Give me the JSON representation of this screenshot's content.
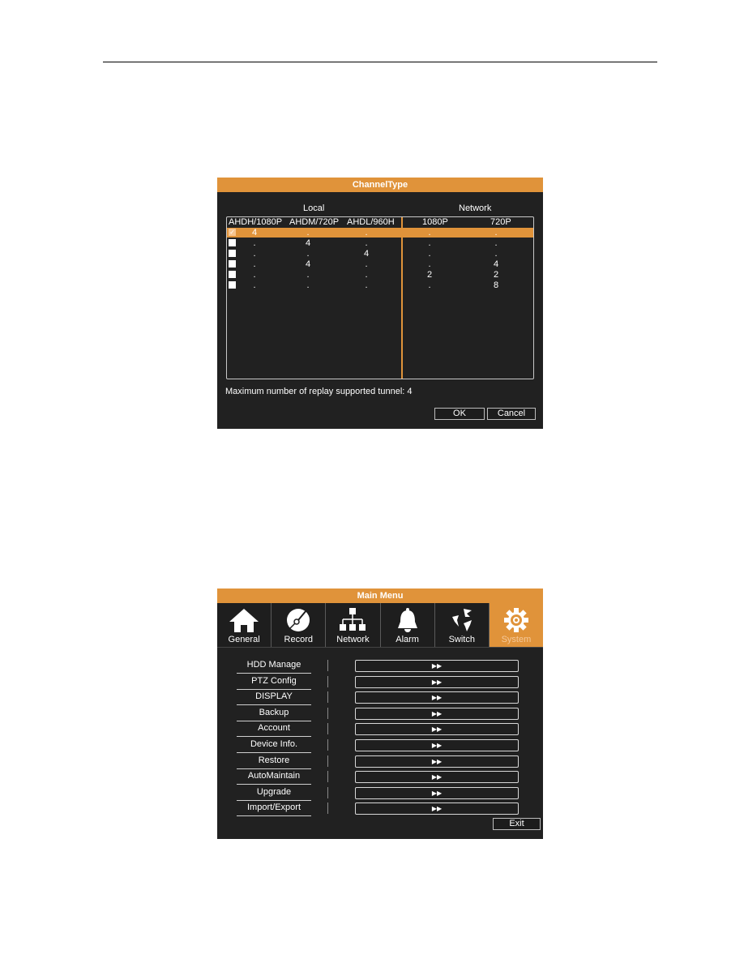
{
  "channel_type": {
    "title": "ChannelType",
    "groups": {
      "local": "Local",
      "network": "Network"
    },
    "columns": [
      "AHDH/1080P",
      "AHDM/720P",
      "AHDL/960H",
      "1080P",
      "720P"
    ],
    "rows": [
      {
        "checked": true,
        "values": [
          "4",
          ".",
          ".",
          ".",
          "."
        ]
      },
      {
        "checked": false,
        "values": [
          ".",
          "4",
          ".",
          ".",
          "."
        ]
      },
      {
        "checked": false,
        "values": [
          ".",
          ".",
          "4",
          ".",
          "."
        ]
      },
      {
        "checked": false,
        "values": [
          ".",
          "4",
          ".",
          ".",
          "4"
        ]
      },
      {
        "checked": false,
        "values": [
          ".",
          ".",
          ".",
          "2",
          "2"
        ]
      },
      {
        "checked": false,
        "values": [
          ".",
          ".",
          ".",
          ".",
          "8"
        ]
      }
    ],
    "check_glyph": "✓",
    "note": "Maximum number of replay supported tunnel: 4",
    "ok_label": "OK",
    "cancel_label": "Cancel"
  },
  "main_menu": {
    "title": "Main Menu",
    "tabs": [
      {
        "label": "General",
        "icon": "home-icon",
        "active": false
      },
      {
        "label": "Record",
        "icon": "disc-icon",
        "active": false
      },
      {
        "label": "Network",
        "icon": "network-icon",
        "active": false
      },
      {
        "label": "Alarm",
        "icon": "bell-icon",
        "active": false
      },
      {
        "label": "Switch",
        "icon": "switch-icon",
        "active": false
      },
      {
        "label": "System",
        "icon": "gear-icon",
        "active": true
      }
    ],
    "items": [
      {
        "label": "HDD Manage"
      },
      {
        "label": "PTZ Config"
      },
      {
        "label": "DISPLAY"
      },
      {
        "label": "Backup"
      },
      {
        "label": "Account"
      },
      {
        "label": "Device Info."
      },
      {
        "label": "Restore"
      },
      {
        "label": "AutoMaintain"
      },
      {
        "label": "Upgrade"
      },
      {
        "label": "Import/Export"
      }
    ],
    "enter_glyph": "▶▶",
    "exit_label": "Exit"
  },
  "colors": {
    "accent": "#e0933a",
    "panel": "#212121"
  }
}
